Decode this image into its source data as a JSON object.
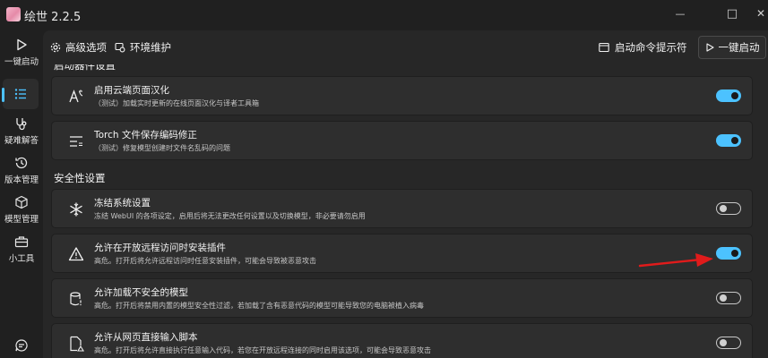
{
  "window": {
    "title": "绘世 2.2.5",
    "min_glyph": "—",
    "max_glyph": "□",
    "close_glyph": "✕"
  },
  "sidebar": {
    "items": [
      {
        "label": "一键启动",
        "icon": "play-icon"
      },
      {
        "label": "",
        "icon": "list-icon",
        "active": true
      },
      {
        "label": "疑难解答",
        "icon": "stethoscope-icon"
      },
      {
        "label": "版本管理",
        "icon": "history-icon"
      },
      {
        "label": "模型管理",
        "icon": "cube-icon"
      },
      {
        "label": "小工具",
        "icon": "toolbox-icon"
      }
    ],
    "bottom_icon": "chat-icon"
  },
  "tabs": [
    {
      "label": "高级选项",
      "icon": "gear-icon"
    },
    {
      "label": "环境维护",
      "icon": "maintenance-icon"
    }
  ],
  "toolbar": {
    "command_prompt_label": "启动命令提示符",
    "launch_label": "一键启动"
  },
  "sections": {
    "startup_partial_title": "启动器件设置",
    "security_title": "安全性设置"
  },
  "settings": {
    "cloud_translation": {
      "title": "启用云端页面汉化",
      "desc": "（测试）加载实时更新的在线页面汉化与译者工具箱",
      "enabled": true
    },
    "torch_fix": {
      "title": "Torch 文件保存编码修正",
      "desc": "（测试）修复模型创建时文件名乱码的问题",
      "enabled": true
    },
    "freeze_settings": {
      "title": "冻结系统设置",
      "desc": "冻结 WebUI 的各项设定，启用后将无法更改任何设置以及切换模型，非必要请勿启用",
      "enabled": false
    },
    "remote_install": {
      "title": "允许在开放远程访问时安装插件",
      "desc": "高危。打开后将允许远程访问时任意安装插件，可能会导致被恶意攻击",
      "enabled": true
    },
    "unsafe_models": {
      "title": "允许加载不安全的模型",
      "desc": "高危。打开后将禁用内置的模型安全性过滤，若加载了含有恶意代码的模型可能导致您的电脑被植入病毒",
      "enabled": false
    },
    "web_script": {
      "title": "允许从网页直接输入脚本",
      "desc": "高危。打开后将允许直接执行任意输入代码，若您在开放远程连接的同时启用该选项，可能会导致恶意攻击",
      "enabled": false
    }
  },
  "colors": {
    "accent": "#4cc2ff",
    "annotation_arrow": "#e01b1b"
  }
}
